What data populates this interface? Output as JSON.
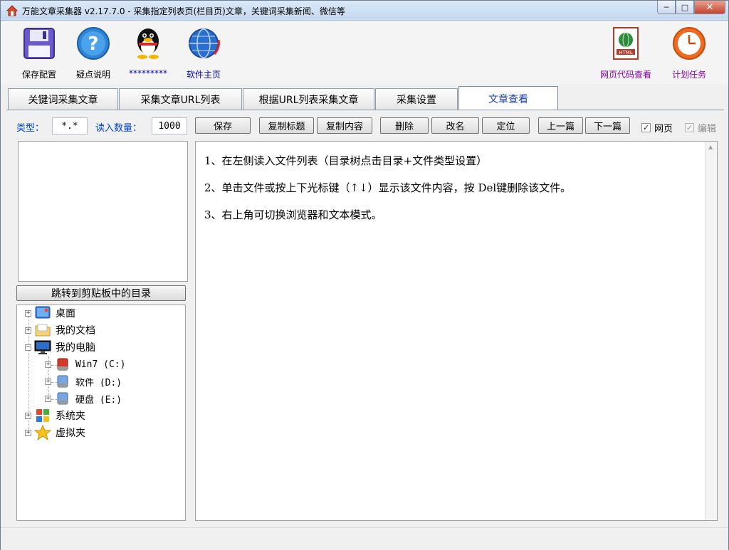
{
  "window": {
    "title": "万能文章采集器 v2.17.7.0 - 采集指定列表页(栏目页)文章，关键词采集新闻、微信等",
    "min_label": "─",
    "max_label": "□",
    "close_label": "✕"
  },
  "toolbar": {
    "save_config": "保存配置",
    "faq": "疑点说明",
    "qq": "*********",
    "homepage": "软件主页",
    "html_view": "网页代码查看",
    "schedule": "计划任务"
  },
  "tabs": [
    {
      "label": "关键词采集文章"
    },
    {
      "label": "采集文章URL列表"
    },
    {
      "label": "根据URL列表采集文章"
    },
    {
      "label": "采集设置"
    },
    {
      "label": "文章查看"
    }
  ],
  "controls": {
    "type_label": "类型：",
    "type_value": "*.*",
    "count_label": "读入数量：",
    "count_value": "1000",
    "save": "保存",
    "copy_title": "复制标题",
    "copy_content": "复制内容",
    "delete": "删除",
    "rename": "改名",
    "locate": "定位",
    "prev": "上一篇",
    "next": "下一篇",
    "webpage": "网页",
    "edit": "编辑",
    "check_mark": "✓"
  },
  "left": {
    "jump_button": "跳转到剪贴板中的目录",
    "tree": [
      {
        "label": "桌面",
        "expander": "+"
      },
      {
        "label": "我的文档",
        "expander": "+"
      },
      {
        "label": "我的电脑",
        "expander": "−"
      },
      {
        "label": "Win7 (C:)",
        "expander": "+"
      },
      {
        "label": "软件 (D:)",
        "expander": "+"
      },
      {
        "label": "硬盘 (E:)",
        "expander": "+"
      },
      {
        "label": "系统夹",
        "expander": "+"
      },
      {
        "label": "虚拟夹",
        "expander": "+"
      }
    ]
  },
  "content": {
    "line1": "1、在左侧读入文件列表（目录树点击目录+文件类型设置）",
    "line2": "2、单击文件或按上下光标键（↑↓）显示该文件内容，按 Del键删除该文件。",
    "line3": "3、右上角可切换浏览器和文本模式。"
  },
  "colors": {
    "accent_blue": "#0046c8",
    "tab_active_text": "#1a3fae"
  }
}
